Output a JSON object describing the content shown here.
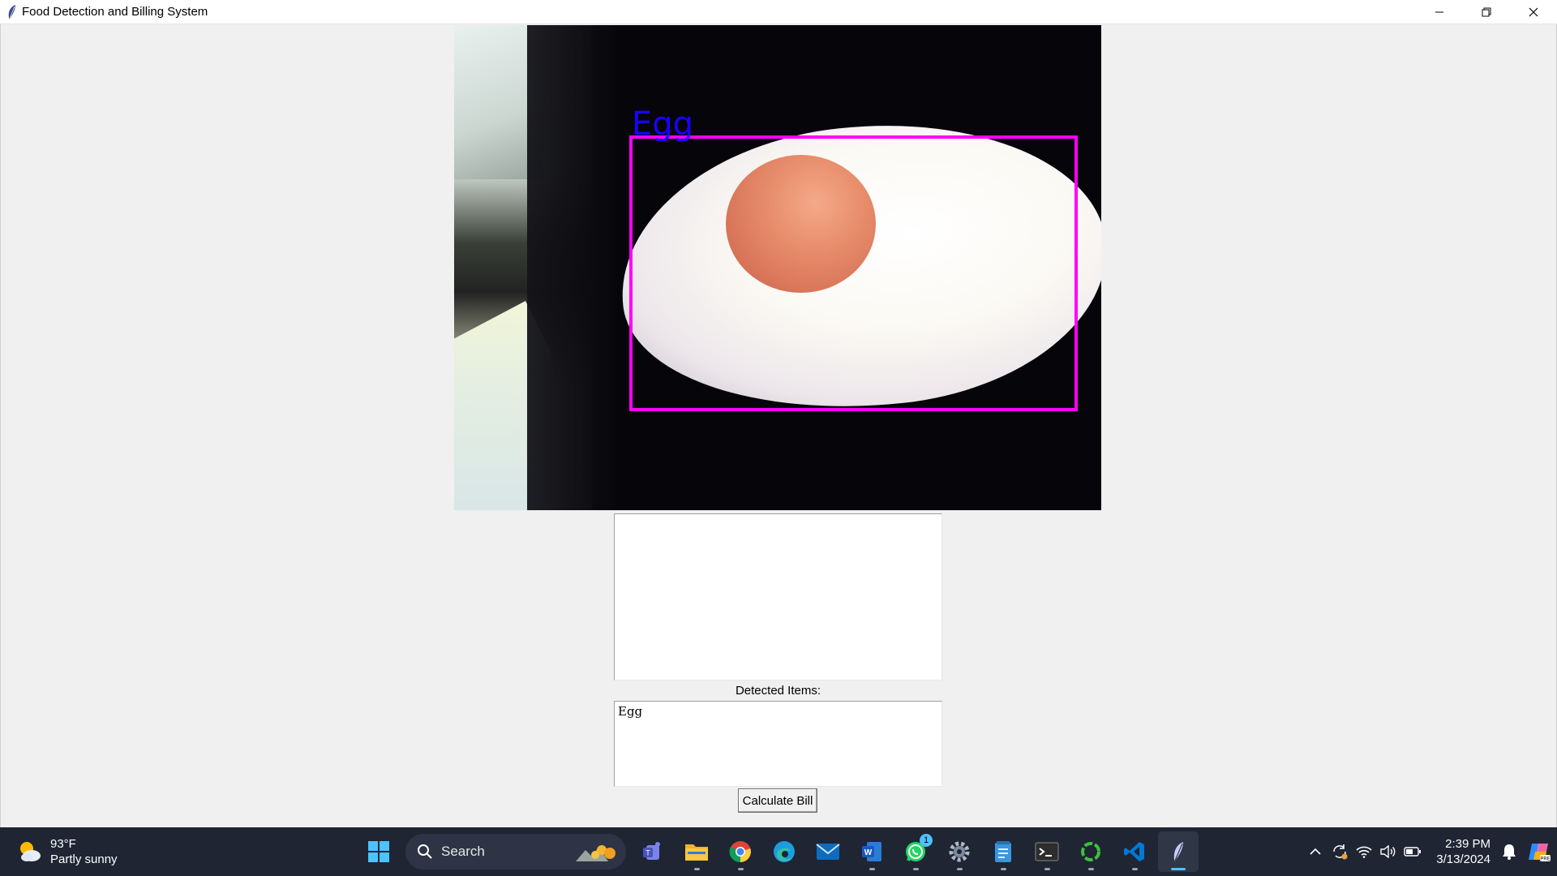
{
  "window": {
    "title": "Food Detection and Billing System"
  },
  "camera": {
    "detection_label": "Egg",
    "box_color": "#ff00ff",
    "label_color": "#1a00ff"
  },
  "labels": {
    "detected_items": "Detected Items:"
  },
  "detected_items_text": "Egg",
  "buttons": {
    "calculate_bill": "Calculate Bill"
  },
  "taskbar": {
    "weather": {
      "temperature": "93°F",
      "condition": "Partly sunny"
    },
    "search_placeholder": "Search",
    "pinned": [
      "start-icon",
      "search",
      "teams-icon",
      "file-explorer-icon",
      "chrome-icon",
      "edge-icon",
      "mail-icon",
      "word-icon",
      "whatsapp-icon",
      "settings-icon",
      "notepad-icon",
      "terminal-icon",
      "spinner-app-icon",
      "vscode-icon",
      "tkinter-feather-icon"
    ],
    "whatsapp_badge": "1",
    "clock": {
      "time": "2:39 PM",
      "date": "3/13/2024"
    }
  }
}
